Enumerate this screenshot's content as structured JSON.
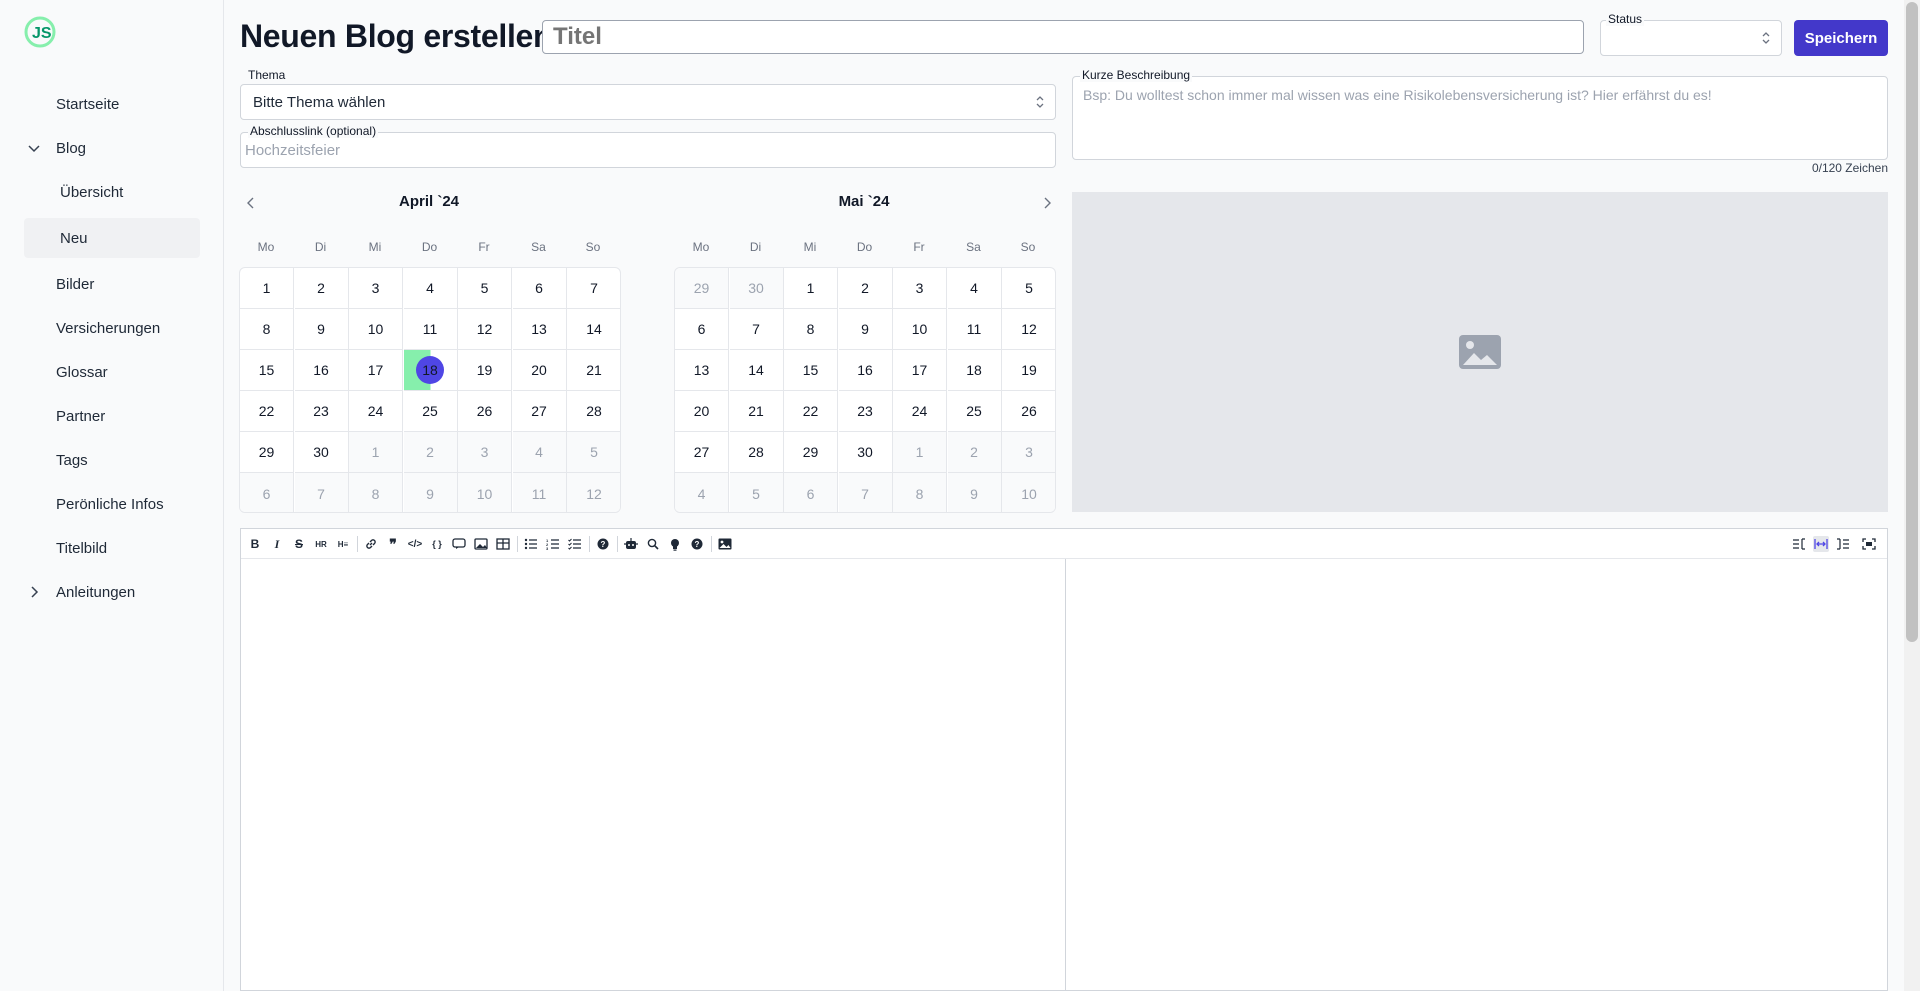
{
  "sidebar": {
    "items": [
      {
        "label": "Startseite"
      },
      {
        "label": "Blog"
      },
      {
        "label": "Übersicht"
      },
      {
        "label": "Neu"
      },
      {
        "label": "Bilder"
      },
      {
        "label": "Versicherungen"
      },
      {
        "label": "Glossar"
      },
      {
        "label": "Partner"
      },
      {
        "label": "Tags"
      },
      {
        "label": "Perönliche Infos"
      },
      {
        "label": "Titelbild"
      },
      {
        "label": "Anleitungen"
      }
    ]
  },
  "header": {
    "title": "Neuen Blog erstellen",
    "title_placeholder": "Titel",
    "status_label": "Status",
    "status_value": "",
    "save_label": "Speichern"
  },
  "form": {
    "topic_label": "Thema",
    "topic_value": "Bitte Thema wählen",
    "link_label": "Abschlusslink (optional)",
    "link_placeholder": "Hochzeitsfeier",
    "desc_label": "Kurze Beschreibung",
    "desc_placeholder": "Bsp: Du wolltest schon immer mal wissen was eine Risikolebensversicherung ist? Hier erfährst du es!",
    "desc_counter": "0/120 Zeichen"
  },
  "calendar": {
    "weekdays": [
      "Mo",
      "Di",
      "Mi",
      "Do",
      "Fr",
      "Sa",
      "So"
    ],
    "months": [
      {
        "title": "April `24",
        "days": [
          [
            "1",
            0
          ],
          [
            "2",
            0
          ],
          [
            "3",
            0
          ],
          [
            "4",
            0
          ],
          [
            "5",
            0
          ],
          [
            "6",
            0
          ],
          [
            "7",
            0
          ],
          [
            "8",
            0
          ],
          [
            "9",
            0
          ],
          [
            "10",
            0
          ],
          [
            "11",
            0
          ],
          [
            "12",
            0
          ],
          [
            "13",
            0
          ],
          [
            "14",
            0
          ],
          [
            "15",
            0
          ],
          [
            "16",
            0
          ],
          [
            "17",
            0
          ],
          [
            "18",
            2
          ],
          [
            "19",
            0
          ],
          [
            "20",
            0
          ],
          [
            "21",
            0
          ],
          [
            "22",
            0
          ],
          [
            "23",
            0
          ],
          [
            "24",
            0
          ],
          [
            "25",
            0
          ],
          [
            "26",
            0
          ],
          [
            "27",
            0
          ],
          [
            "28",
            0
          ],
          [
            "29",
            0
          ],
          [
            "30",
            0
          ],
          [
            "1",
            1
          ],
          [
            "2",
            1
          ],
          [
            "3",
            1
          ],
          [
            "4",
            1
          ],
          [
            "5",
            1
          ],
          [
            "6",
            1
          ],
          [
            "7",
            1
          ],
          [
            "8",
            1
          ],
          [
            "9",
            1
          ],
          [
            "10",
            1
          ],
          [
            "11",
            1
          ],
          [
            "12",
            1
          ]
        ]
      },
      {
        "title": "Mai `24",
        "days": [
          [
            "29",
            1
          ],
          [
            "30",
            1
          ],
          [
            "1",
            0
          ],
          [
            "2",
            0
          ],
          [
            "3",
            0
          ],
          [
            "4",
            0
          ],
          [
            "5",
            0
          ],
          [
            "6",
            0
          ],
          [
            "7",
            0
          ],
          [
            "8",
            0
          ],
          [
            "9",
            0
          ],
          [
            "10",
            0
          ],
          [
            "11",
            0
          ],
          [
            "12",
            0
          ],
          [
            "13",
            0
          ],
          [
            "14",
            0
          ],
          [
            "15",
            0
          ],
          [
            "16",
            0
          ],
          [
            "17",
            0
          ],
          [
            "18",
            0
          ],
          [
            "19",
            0
          ],
          [
            "20",
            0
          ],
          [
            "21",
            0
          ],
          [
            "22",
            0
          ],
          [
            "23",
            0
          ],
          [
            "24",
            0
          ],
          [
            "25",
            0
          ],
          [
            "26",
            0
          ],
          [
            "27",
            0
          ],
          [
            "28",
            0
          ],
          [
            "29",
            0
          ],
          [
            "30",
            0
          ],
          [
            "1",
            1
          ],
          [
            "2",
            1
          ],
          [
            "3",
            1
          ],
          [
            "4",
            1
          ],
          [
            "5",
            1
          ],
          [
            "6",
            1
          ],
          [
            "7",
            1
          ],
          [
            "8",
            1
          ],
          [
            "9",
            1
          ],
          [
            "10",
            1
          ]
        ]
      }
    ]
  },
  "editor": {
    "toolbar": [
      "bold-icon",
      "italic-icon",
      "strikethrough-icon",
      "hr-icon",
      "heading-icon",
      "link-icon",
      "quote-icon",
      "code-icon",
      "code-block-icon",
      "comment-icon",
      "image-icon",
      "table-icon",
      "unordered-list-icon",
      "ordered-list-icon",
      "checklist-icon",
      "help-icon",
      "robot-icon",
      "search-icon",
      "lightbulb-icon",
      "help-circle-icon",
      "picture-icon"
    ],
    "view_modes": [
      "editor-only-icon",
      "split-view-icon",
      "preview-only-icon",
      "fullscreen-icon"
    ]
  },
  "colors": {
    "accent": "#4338ca",
    "selected_day": "#4f46e5",
    "range_highlight": "#86efac"
  }
}
